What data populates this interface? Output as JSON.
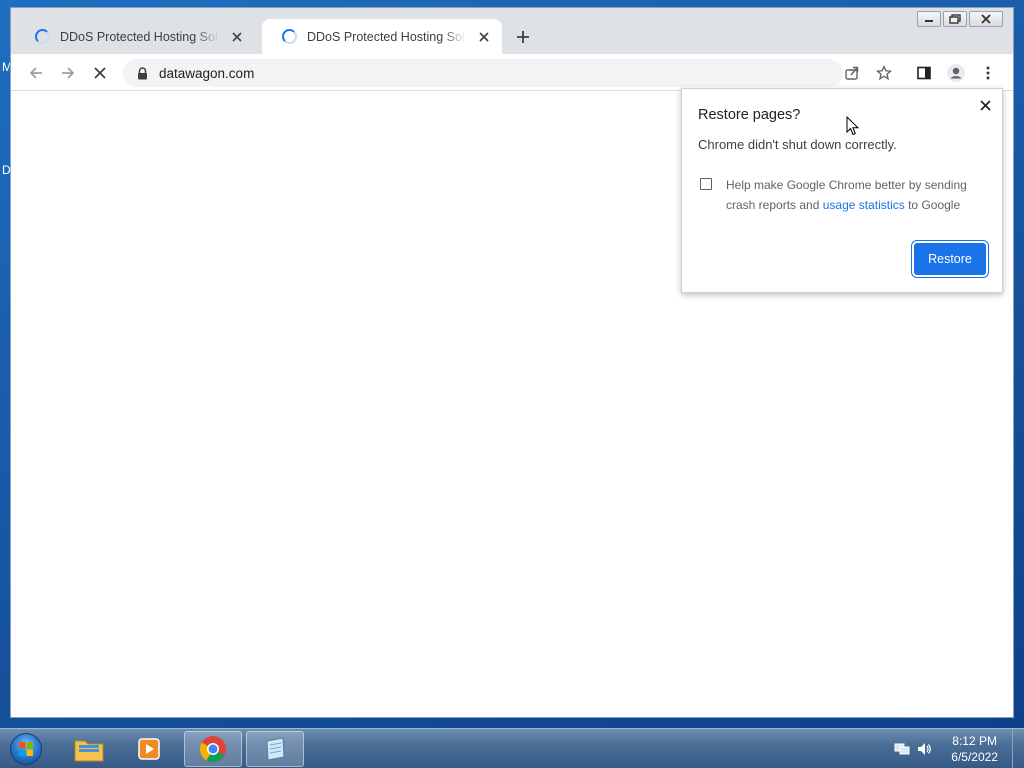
{
  "desktop": {
    "edge_letter_1": "M",
    "edge_letter_2": "D"
  },
  "tabs": [
    {
      "title": "DDoS Protected Hosting Solutions",
      "active": false
    },
    {
      "title": "DDoS Protected Hosting Solutions",
      "active": true
    }
  ],
  "toolbar": {
    "url": "datawagon.com"
  },
  "restore_bubble": {
    "heading": "Restore pages?",
    "message": "Chrome didn't shut down correctly.",
    "checkbox_text_before": "Help make Google Chrome better by sending crash reports and ",
    "checkbox_link": "usage statistics",
    "checkbox_text_after": " to Google",
    "checkbox_checked": false,
    "restore_button": "Restore"
  },
  "taskbar": {
    "apps": [
      "Windows Explorer",
      "Windows Media Player",
      "Google Chrome",
      "Notepad"
    ],
    "time": "8:12 PM",
    "date": "6/5/2022"
  },
  "colors": {
    "accent": "#1a73e8",
    "tabstrip": "#dee1e6"
  }
}
